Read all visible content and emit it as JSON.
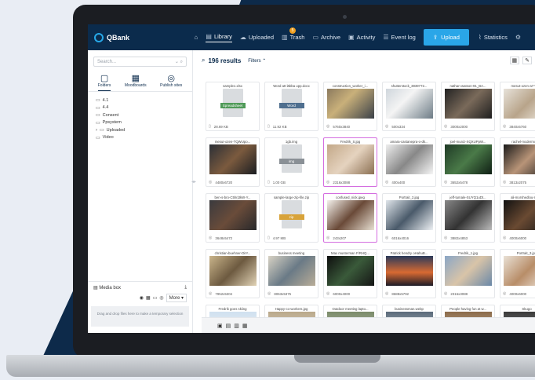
{
  "app": {
    "brand": "QBank"
  },
  "nav": {
    "items": [
      {
        "icon": "home-icon",
        "label": ""
      },
      {
        "icon": "library-icon",
        "label": "Library"
      },
      {
        "icon": "cloud-icon",
        "label": "Uploaded"
      },
      {
        "icon": "trash-icon",
        "label": "Trash",
        "badge": "5"
      },
      {
        "icon": "archive-icon",
        "label": "Archive"
      },
      {
        "icon": "activity-icon",
        "label": "Activity"
      },
      {
        "icon": "list-icon",
        "label": "Event log"
      }
    ],
    "upload": "Upload",
    "statistics": "Statistics"
  },
  "sidebar": {
    "search_placeholder": "Search...",
    "tabs": [
      "Folders",
      "Moodboards",
      "Publish sites"
    ],
    "folders": [
      "4.1",
      "4.4",
      "Consent",
      "Ppsystem",
      "Uploaded",
      "Video"
    ],
    "media_box": {
      "title": "Media box",
      "more": "More",
      "dropzone": "Drag and drop files here to make a temporary selection"
    }
  },
  "main": {
    "results": "196 results",
    "filters": "Filters"
  },
  "cards": [
    {
      "name": "sample1.xlsx",
      "meta": "28.69 KB",
      "type": "doc",
      "tag": "Spreadsheet",
      "tagColor": "#4f9a58"
    },
    {
      "name": "Word att läbba upp.docx",
      "meta": "11.92 KB",
      "type": "doc",
      "tag": "Word",
      "tagColor": "#4f6f8f"
    },
    {
      "name": "construction_worker_i...",
      "meta": "5760x3840",
      "type": "img",
      "bg": "linear-gradient(135deg,#8b7a5e,#c9b07a 40%,#3a4048)"
    },
    {
      "name": "shutterstock_3839772...",
      "meta": "500x334",
      "type": "img",
      "bg": "linear-gradient(135deg,#cfd6dc,#f4f4f4 40%,#6d7c86)"
    },
    {
      "name": "nathan-watson-91_BA...",
      "meta": "3000x2000",
      "type": "img",
      "bg": "linear-gradient(135deg,#222,#7a6a5a 50%,#1e1e1e)"
    },
    {
      "name": "mesut-ozen-a7-Wg...",
      "meta": "3840x5760",
      "type": "img",
      "bg": "linear-gradient(135deg,#e7e2da,#b8a48a 50%,#f3efe8)"
    },
    {
      "name": "mesut-ozen-TQWUpo...",
      "meta": "4480x6720",
      "type": "img",
      "bg": "linear-gradient(135deg,#2b2f36,#7b5a3e 50%,#1a1d22)"
    },
    {
      "name": "1gb.img",
      "meta": "1.00 GB",
      "type": "doc",
      "tag": "img",
      "tagColor": "#8a9096"
    },
    {
      "name": "Fredrik_S.jpg",
      "meta": "2316x3088",
      "type": "img",
      "bg": "linear-gradient(135deg,#c3a888,#e5d3bf 50%,#8b6f52)",
      "selected": true
    },
    {
      "name": "amara-castanepra-o-dk...",
      "meta": "400x400",
      "type": "img",
      "bg": "linear-gradient(135deg,#eee,#888 50%,#f6f6f6)"
    },
    {
      "name": "joel-muniz-XQXUPpW...",
      "meta": "3652x5478",
      "type": "img",
      "bg": "linear-gradient(135deg,#1f3a26,#4a7a48 50%,#0f1f14)"
    },
    {
      "name": "rachel-mcdermott-...",
      "meta": "3813x2075",
      "type": "img",
      "bg": "linear-gradient(135deg,#1a1a1a,#b89478 50%,#222)"
    },
    {
      "name": "ben-s-bro-C5hrj3kW-Y...",
      "meta": "3648x5472",
      "type": "img",
      "bg": "linear-gradient(135deg,#3a3a3e,#6a4c3a 50%,#27282b)"
    },
    {
      "name": "sample-large-zip-file.zip",
      "meta": "4.97 MB",
      "type": "doc",
      "tag": "zip",
      "tagColor": "#d8a33a"
    },
    {
      "name": "confused_nick.jpeg",
      "meta": "243x207",
      "type": "img",
      "bg": "linear-gradient(135deg,#f4f1ec,#6a4a38 50%,#e7dfd2)",
      "selected": true
    },
    {
      "name": "Portrait_2.jpg",
      "meta": "6016x4016",
      "type": "img",
      "bg": "linear-gradient(135deg,#dfe5ea,#4a5a6a 50%,#eef1f4)"
    },
    {
      "name": "jeff-tumale-SUYQ1uDt...",
      "meta": "3882x4853",
      "type": "img",
      "bg": "linear-gradient(135deg,#888,#333 50%,#bbb)"
    },
    {
      "name": "ali-morshedlou-WM...",
      "meta": "4000x6000",
      "type": "img",
      "bg": "linear-gradient(135deg,#111,#6a4a32 50%,#1a1a1a)"
    },
    {
      "name": "christian-buehner-DiIY...",
      "meta": "7952x5304",
      "type": "img",
      "bg": "linear-gradient(135deg,#c9b48a,#6d5a40 50%,#e1d3b6)"
    },
    {
      "name": "business meeting",
      "meta": "8063x5375",
      "type": "img",
      "bg": "linear-gradient(135deg,#d8d2c4,#6a7a86 50%,#b9ad98)"
    },
    {
      "name": "Max musterman F/RHQ...",
      "meta": "6000x4000",
      "type": "img",
      "bg": "linear-gradient(135deg,#0e0e0e,#3a5a3a 50%,#151515)"
    },
    {
      "name": "Patrick hendry oHahuB...",
      "meta": "8688x5792",
      "type": "img",
      "bg": "linear-gradient(180deg,#2a3a5a,#d86a32 55%,#1c1c28)"
    },
    {
      "name": "Fredrik_1.jpg",
      "meta": "2316x3088",
      "type": "img",
      "bg": "linear-gradient(135deg,#8aa6c6,#d9c4a8 50%,#6a88a8)"
    },
    {
      "name": "Portrait_3.jpg",
      "meta": "4000x6000",
      "type": "img",
      "bg": "linear-gradient(135deg,#e9e1d6,#b88d68 50%,#f2ece4)"
    },
    {
      "name": "Fredrik goes skiing",
      "meta": "",
      "type": "img",
      "bg": "linear-gradient(180deg,#cfe0ef,#f5f7fa)"
    },
    {
      "name": "Happy-co-workers.jpg",
      "meta": "",
      "type": "img",
      "bg": "linear-gradient(180deg,#b9a88a,#e9e2d6)"
    },
    {
      "name": "Outdoor meeting lapto...",
      "meta": "",
      "type": "img",
      "bg": "linear-gradient(180deg,#7a8a6a,#c9d2b9)"
    },
    {
      "name": "businessman.webp",
      "meta": "",
      "type": "img",
      "bg": "linear-gradient(180deg,#5a6a7a,#d2d8de)"
    },
    {
      "name": "People having fun at w...",
      "meta": "",
      "type": "img",
      "bg": "linear-gradient(180deg,#8a6a4a,#e2cfb6)"
    },
    {
      "name": "Skugo",
      "meta": "",
      "type": "img",
      "bg": "linear-gradient(180deg,#3a3a3a,#9a9a9a)"
    }
  ],
  "colors": {
    "navbar": "#0b2b4c",
    "accent": "#2aa6e8",
    "selected": "#d46de0"
  }
}
